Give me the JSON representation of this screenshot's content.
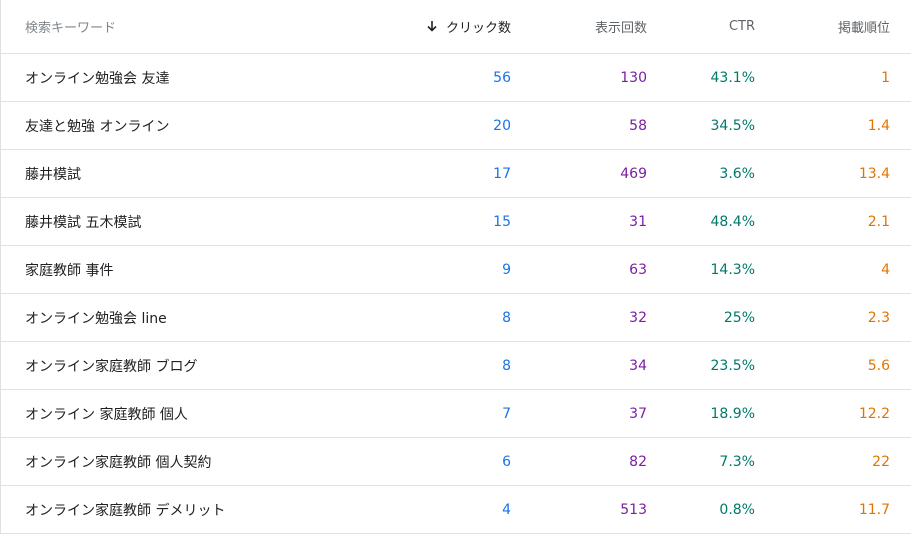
{
  "headers": {
    "keyword": "検索キーワード",
    "clicks": "クリック数",
    "impressions": "表示回数",
    "ctr": "CTR",
    "position": "掲載順位"
  },
  "sort": {
    "column": "clicks",
    "direction": "descending",
    "icon": "arrow-down-icon"
  },
  "colors": {
    "clicks": "#1a73e8",
    "impressions": "#7b1fa2",
    "ctr": "#00796b",
    "position": "#e37400"
  },
  "rows": [
    {
      "keyword": "オンライン勉強会 友達",
      "clicks": "56",
      "impressions": "130",
      "ctr": "43.1%",
      "position": "1"
    },
    {
      "keyword": "友達と勉強 オンライン",
      "clicks": "20",
      "impressions": "58",
      "ctr": "34.5%",
      "position": "1.4"
    },
    {
      "keyword": "藤井模試",
      "clicks": "17",
      "impressions": "469",
      "ctr": "3.6%",
      "position": "13.4"
    },
    {
      "keyword": "藤井模試 五木模試",
      "clicks": "15",
      "impressions": "31",
      "ctr": "48.4%",
      "position": "2.1"
    },
    {
      "keyword": "家庭教師 事件",
      "clicks": "9",
      "impressions": "63",
      "ctr": "14.3%",
      "position": "4"
    },
    {
      "keyword": "オンライン勉強会 line",
      "clicks": "8",
      "impressions": "32",
      "ctr": "25%",
      "position": "2.3"
    },
    {
      "keyword": "オンライン家庭教師 ブログ",
      "clicks": "8",
      "impressions": "34",
      "ctr": "23.5%",
      "position": "5.6"
    },
    {
      "keyword": "オンライン 家庭教師 個人",
      "clicks": "7",
      "impressions": "37",
      "ctr": "18.9%",
      "position": "12.2"
    },
    {
      "keyword": "オンライン家庭教師 個人契約",
      "clicks": "6",
      "impressions": "82",
      "ctr": "7.3%",
      "position": "22"
    },
    {
      "keyword": "オンライン家庭教師 デメリット",
      "clicks": "4",
      "impressions": "513",
      "ctr": "0.8%",
      "position": "11.7"
    }
  ]
}
